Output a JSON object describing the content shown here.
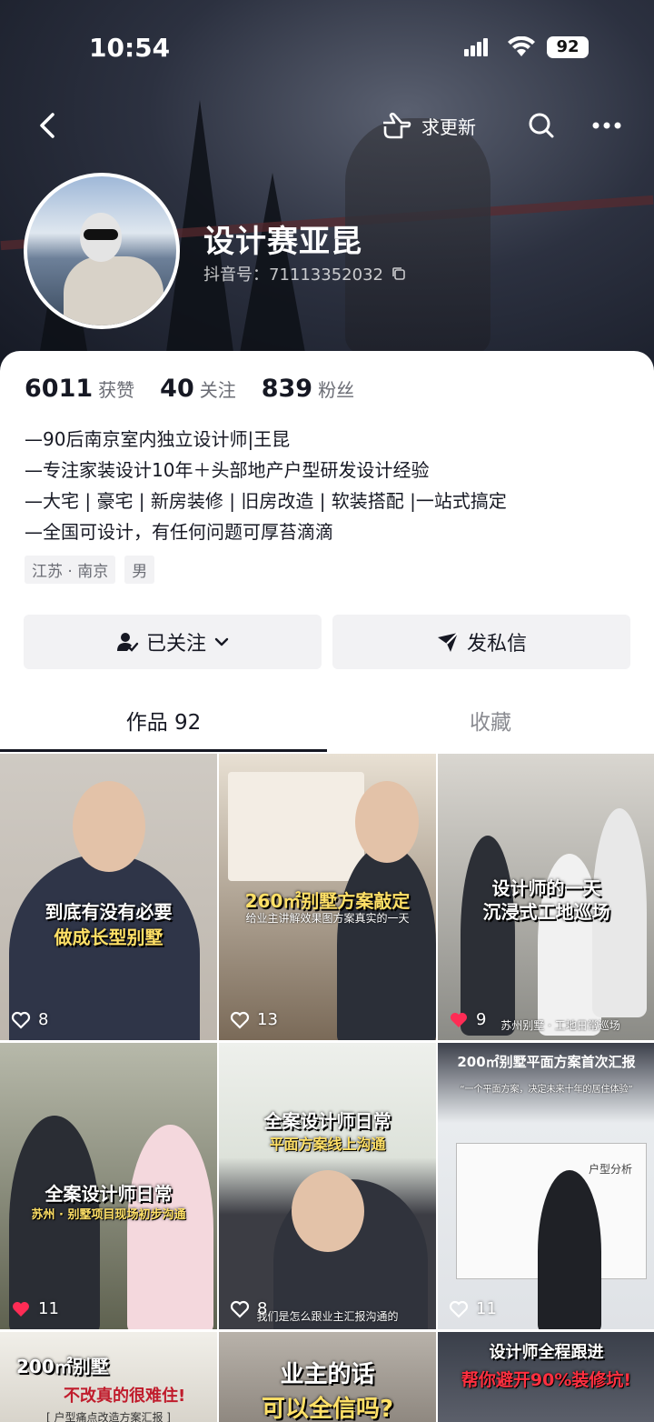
{
  "status": {
    "time": "10:54",
    "battery": "92"
  },
  "nav": {
    "request_update": "求更新"
  },
  "profile": {
    "name": "设计赛亚昆",
    "douyin_id": "抖音号：71113352032"
  },
  "stats": [
    {
      "num": "6011",
      "label": "获赞"
    },
    {
      "num": "40",
      "label": "关注"
    },
    {
      "num": "839",
      "label": "粉丝"
    }
  ],
  "bio": [
    "—90后南京室内独立设计师|王昆",
    "—专注家装设计10年＋头部地产户型研发设计经验",
    "—大宅 | 豪宅 | 新房装修 | 旧房改造 | 软装搭配 |一站式搞定",
    "—全国可设计，有任何问题可厚苔滴滴"
  ],
  "tags": [
    "江苏 · 南京",
    "男"
  ],
  "actions": {
    "follow": "已关注",
    "message": "发私信"
  },
  "tabs": {
    "works": "作品 92",
    "favorites": "收藏"
  },
  "videos": [
    {
      "caption1": "到底有没有必要",
      "caption2": "做成长型别墅",
      "likes": "8",
      "liked": false
    },
    {
      "caption1": "260㎡别墅方案敲定",
      "caption2": "给业主讲解效果图方案真实的一天",
      "likes": "13",
      "liked": false
    },
    {
      "caption1": "设计师的一天",
      "caption2": "沉浸式工地巡场",
      "small": "苏州别墅 · 工地日常巡场",
      "likes": "9",
      "liked": true
    },
    {
      "caption1": "全案设计师日常",
      "caption2": "苏州 · 别墅项目现场初步沟通",
      "likes": "11",
      "liked": true
    },
    {
      "caption1": "全案设计师日常",
      "caption2": "平面方案线上沟通",
      "small": "我们是怎么跟业主汇报沟通的",
      "likes": "8",
      "liked": false
    },
    {
      "caption1": "200㎡别墅平面方案首次汇报",
      "caption2": "“一个平面方案，决定未来十年的居住体验”",
      "small": "户型分析",
      "likes": "11",
      "liked": false
    },
    {
      "caption1": "200㎡别墅",
      "caption2": "不改真的很难住!",
      "small": "[ 户型痛点改造方案汇报 ]"
    },
    {
      "caption1": "业主的话",
      "caption2": "可以全信吗?"
    },
    {
      "caption1": "设计师全程跟进",
      "caption2": "帮你避开90%装修坑!"
    }
  ]
}
